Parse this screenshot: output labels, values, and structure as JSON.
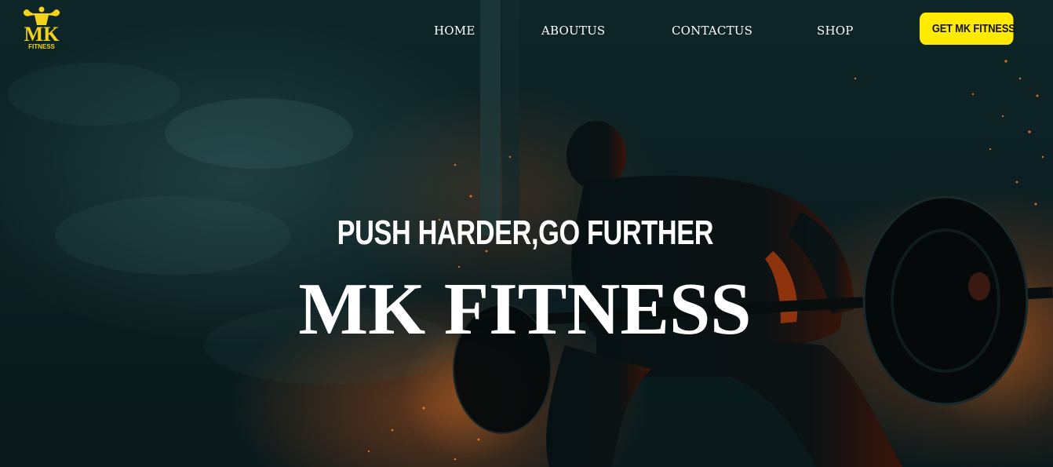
{
  "brand": {
    "logo_text": "MK",
    "logo_subtext": "FITNESS",
    "accent_color": "#ffea00"
  },
  "nav": {
    "items": [
      {
        "label": "HOME"
      },
      {
        "label": "ABOUTUS"
      },
      {
        "label": "CONTACTUS"
      },
      {
        "label": "SHOP"
      }
    ],
    "cta_label": "GET MK FITNESS"
  },
  "hero": {
    "tagline": "PUSH HARDER,GO FURTHER",
    "title": "MK FITNESS",
    "background_image": "athlete-lifting-barbell-silhouette"
  }
}
